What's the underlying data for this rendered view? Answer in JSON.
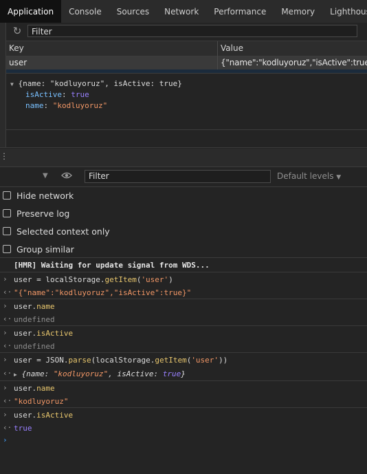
{
  "tabs": [
    "Application",
    "Console",
    "Sources",
    "Network",
    "Performance",
    "Memory",
    "Lighthouse"
  ],
  "storage": {
    "filter_placeholder": "Filter",
    "key_header": "Key",
    "value_header": "Value",
    "row": {
      "key": "user",
      "value": "{\"name\":\"kodluyoruz\",\"isActive\":true}"
    },
    "preview": {
      "summary": "{name: \"kodluyoruz\", isActive: true}",
      "isActive_key": "isActive",
      "isActive_val": "true",
      "name_key": "name",
      "name_val": "\"kodluyoruz\""
    }
  },
  "console_toolbar": {
    "filter_placeholder": "Filter",
    "levels": "Default levels"
  },
  "settings": [
    "Hide network",
    "Preserve log",
    "Selected context only",
    "Group similar"
  ],
  "log": {
    "hmr": "[HMR] Waiting for update signal from WDS...",
    "l1_var": "user = localStorage.",
    "l1_fn": "getItem",
    "l1_arg": "'user'",
    "l1_result": "\"{\"name\":\"kodluyoruz\",\"isActive\":true}\"",
    "l2_obj": "user.",
    "l2_prop": "name",
    "l2_result": "undefined",
    "l3_obj": "user.",
    "l3_prop": "isActive",
    "l3_result": "undefined",
    "l4_a": "user = JSON.",
    "l4_fn": "parse",
    "l4_b": "(localStorage.",
    "l4_fn2": "getItem",
    "l4_arg": "'user'",
    "l4_result_a": "{name: ",
    "l4_result_name": "\"kodluyoruz\"",
    "l4_result_b": ", isActive: ",
    "l4_result_true": "true",
    "l4_result_c": "}",
    "l5_obj": "user.",
    "l5_prop": "name",
    "l5_result": "\"kodluyoruz\"",
    "l6_obj": "user.",
    "l6_prop": "isActive",
    "l6_result": "true"
  },
  "icons": {
    "refresh": "refresh-icon",
    "eye": "eye-icon",
    "expand": "triangle-icon",
    "prompt": "chevron-right-icon"
  },
  "colors": {
    "string": "#f29766",
    "keyword": "#9980ff",
    "prompt": "#3d8bd9",
    "active_tab_bg": "#111111"
  }
}
